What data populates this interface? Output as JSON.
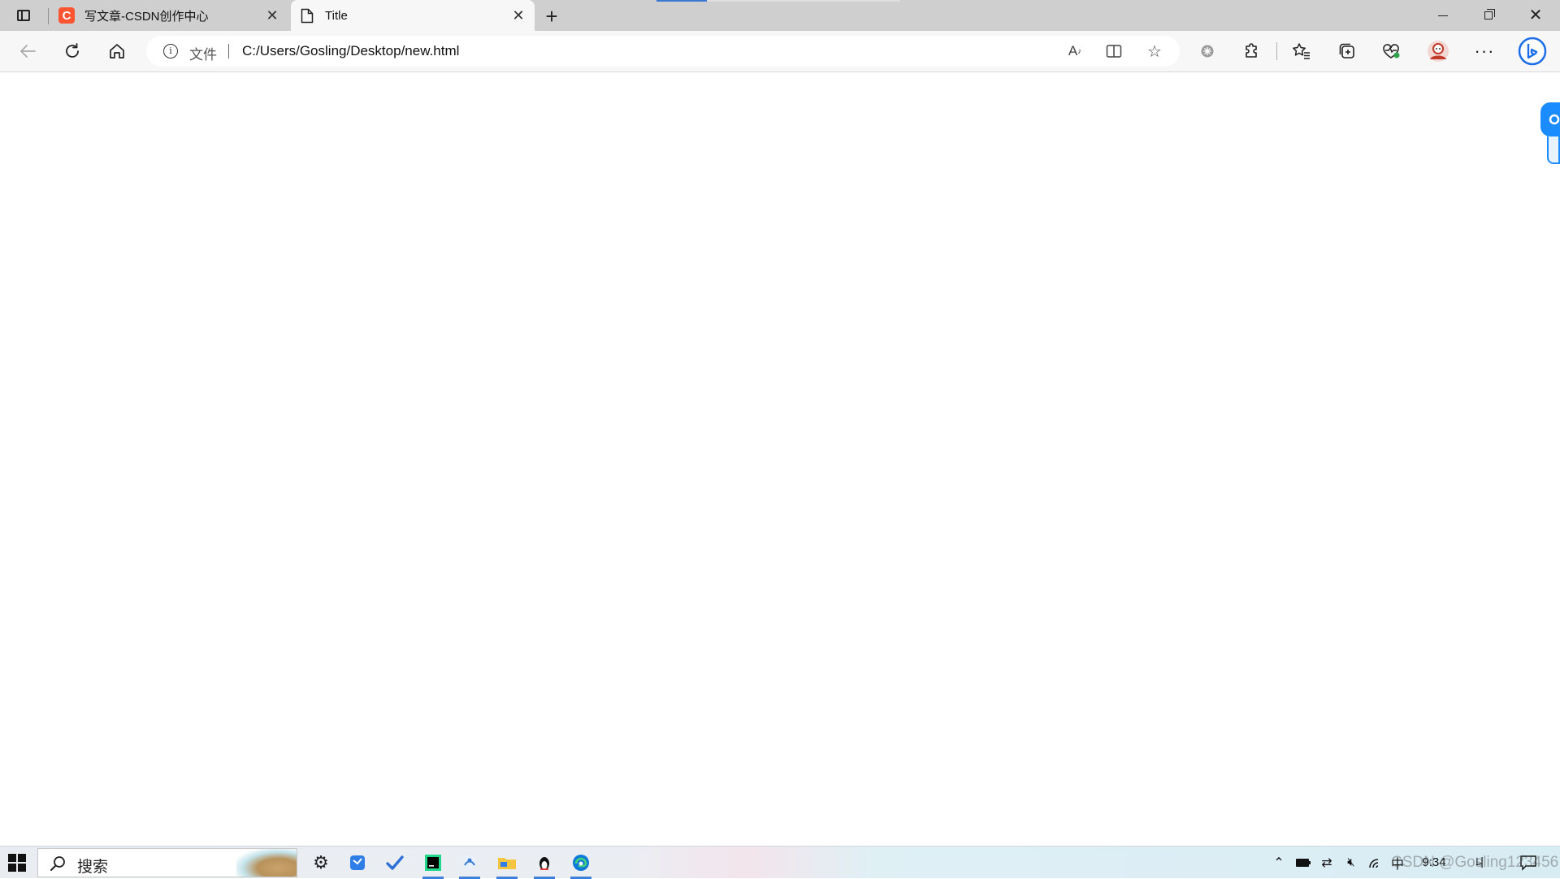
{
  "tabs": [
    {
      "title": "写文章-CSDN创作中心",
      "favicon": "csdn-logo-icon",
      "active": false
    },
    {
      "title": "Title",
      "favicon": "document-icon",
      "active": true
    }
  ],
  "address_bar": {
    "protocol_label": "文件",
    "url": "C:/Users/Gosling/Desktop/new.html"
  },
  "taskbar": {
    "search_placeholder": "搜索",
    "clock": "9:34",
    "ime_lang": "中",
    "ime_mode": "ㄐ",
    "watermark": "CSDN @Gosling123456"
  },
  "colors": {
    "tabstrip": "#cfcfcf",
    "active_tab": "#f7f7f7",
    "csdn_red": "#fc5531",
    "edge_blue": "#1a8cff",
    "load_progress": "#3a78d4"
  },
  "icons": {
    "tab_actions": "tab-actions-icon",
    "new_tab": "plus-icon",
    "back": "back-arrow-icon",
    "refresh": "refresh-icon",
    "home": "home-icon",
    "info": "info-icon",
    "read_aloud": "read-aloud-icon",
    "split_screen": "split-screen-icon",
    "favorite": "star-icon",
    "extensions": "puzzle-icon",
    "favorites": "favorites-list-icon",
    "collections": "collections-icon",
    "browser_essentials": "heart-pulse-icon",
    "profile": "avatar-icon",
    "more": "ellipsis-icon",
    "copilot": "bing-icon"
  }
}
